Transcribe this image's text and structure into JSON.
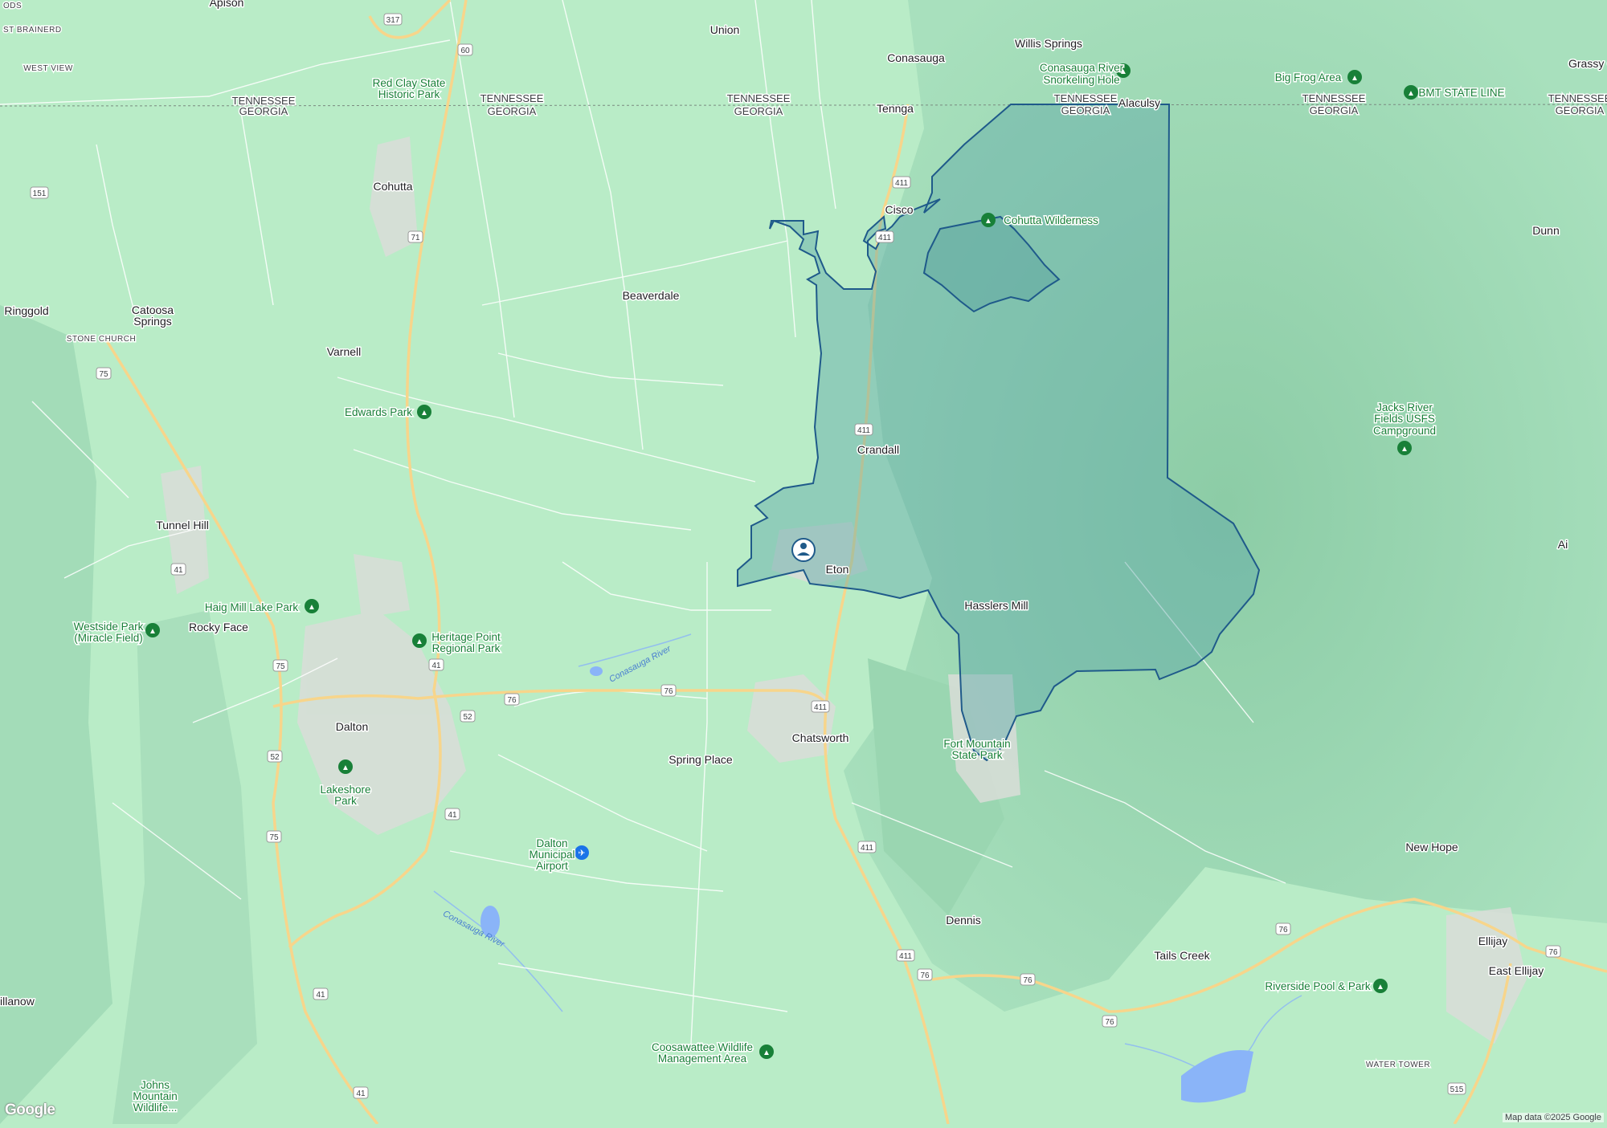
{
  "map": {
    "places": [
      {
        "name": "Apison"
      },
      {
        "name": "Union"
      },
      {
        "name": "Willis Springs"
      },
      {
        "name": "Conasauga"
      },
      {
        "name": "Alaculsy"
      },
      {
        "name": "Tennga"
      },
      {
        "name": "Cohutta"
      },
      {
        "name": "Cisco"
      },
      {
        "name": "Beaverdale"
      },
      {
        "name": "Ringgold"
      },
      {
        "name": "Catoosa"
      },
      {
        "name": "Springs"
      },
      {
        "name": "Varnell"
      },
      {
        "name": "Crandall"
      },
      {
        "name": "Tunnel Hill"
      },
      {
        "name": "Eton"
      },
      {
        "name": "Rocky Face"
      },
      {
        "name": "Hasslers Mill"
      },
      {
        "name": "Dalton"
      },
      {
        "name": "Chatsworth"
      },
      {
        "name": "Spring Place"
      },
      {
        "name": "Dunn"
      },
      {
        "name": "Ai"
      },
      {
        "name": "New Hope"
      },
      {
        "name": "Dennis"
      },
      {
        "name": "Tails Creek"
      },
      {
        "name": "Ellijay"
      },
      {
        "name": "East Ellijay"
      },
      {
        "name": "illanow"
      },
      {
        "name": "Grassy C"
      }
    ],
    "state_labels": [
      {
        "top": "TENNESSEE",
        "bottom": "GEORGIA"
      }
    ],
    "small_caps": [
      "WEST VIEW",
      "ST BRAINERD",
      "ODS",
      "STONE CHURCH",
      "WATER TOWER"
    ],
    "pois": [
      {
        "line1": "Red Clay State",
        "line2": "Historic Park"
      },
      {
        "line1": "Conasauga River",
        "line2": "Snorkeling Hole"
      },
      {
        "line1": "Big Frog Area",
        "line2": ""
      },
      {
        "line1": "BMT STATE LINE",
        "line2": ""
      },
      {
        "line1": "Cohutta Wilderness",
        "line2": ""
      },
      {
        "line1": "Edwards Park",
        "line2": ""
      },
      {
        "line1": "Jacks River",
        "line2": "Fields USFS"
      },
      {
        "line1": "Campground",
        "line2": ""
      },
      {
        "line1": "Haig Mill Lake Park",
        "line2": ""
      },
      {
        "line1": "Heritage Point",
        "line2": "Regional Park"
      },
      {
        "line1": "Westside Park",
        "line2": "(Miracle Field)"
      },
      {
        "line1": "Lakeshore",
        "line2": "Park"
      },
      {
        "line1": "Fort Mountain",
        "line2": "State Park"
      },
      {
        "line1": "Dalton",
        "line2": "Municipal"
      },
      {
        "line1": "Airport",
        "line2": ""
      },
      {
        "line1": "Riverside Pool & Park",
        "line2": ""
      },
      {
        "line1": "Coosawattee Wildlife",
        "line2": "Management Area"
      },
      {
        "line1": "Johns",
        "line2": "Mountain"
      },
      {
        "line1": "Wildlife...",
        "line2": ""
      }
    ],
    "rivers": [
      "Conasauga River",
      "Conasauga River"
    ],
    "shields": [
      "317",
      "60",
      "151",
      "71",
      "411",
      "75",
      "41",
      "52",
      "76",
      "515"
    ],
    "attribution": "Map data ©2025 Google",
    "logo": "Google",
    "colors": {
      "land": "#b9ecc7",
      "mountain": "#93d3b0",
      "boundary_fill": "#5fa9a8",
      "boundary_stroke": "#1f5a8a",
      "park_green": "#188038",
      "road": "#ffffff",
      "highway": "#f7d58b",
      "urban": "#d9ddd8"
    }
  }
}
